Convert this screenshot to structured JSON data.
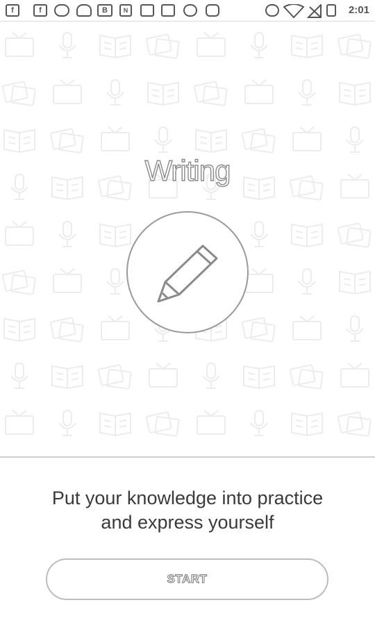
{
  "status_bar": {
    "time": "2:01",
    "left_icons": [
      "facebook-icon",
      "facebook-icon",
      "chat-icon",
      "cat-icon",
      "blog-icon",
      "nfc-icon",
      "square-icon",
      "lock-icon",
      "record-icon",
      "bot-icon"
    ],
    "right_icons": [
      "alarm-icon",
      "wifi-icon",
      "no-signal-icon",
      "battery-icon"
    ],
    "icon_letters": {
      "facebook": "f",
      "blog": "B",
      "nfc": "N"
    }
  },
  "hero": {
    "title": "Writing",
    "icon": "pencil-icon",
    "pattern_icons": [
      "tv-icon",
      "microphone-icon",
      "book-icon",
      "cards-icon"
    ]
  },
  "tagline": {
    "line1": "Put your knowledge into practice",
    "line2": "and express yourself"
  },
  "start_button": {
    "label": "START"
  }
}
